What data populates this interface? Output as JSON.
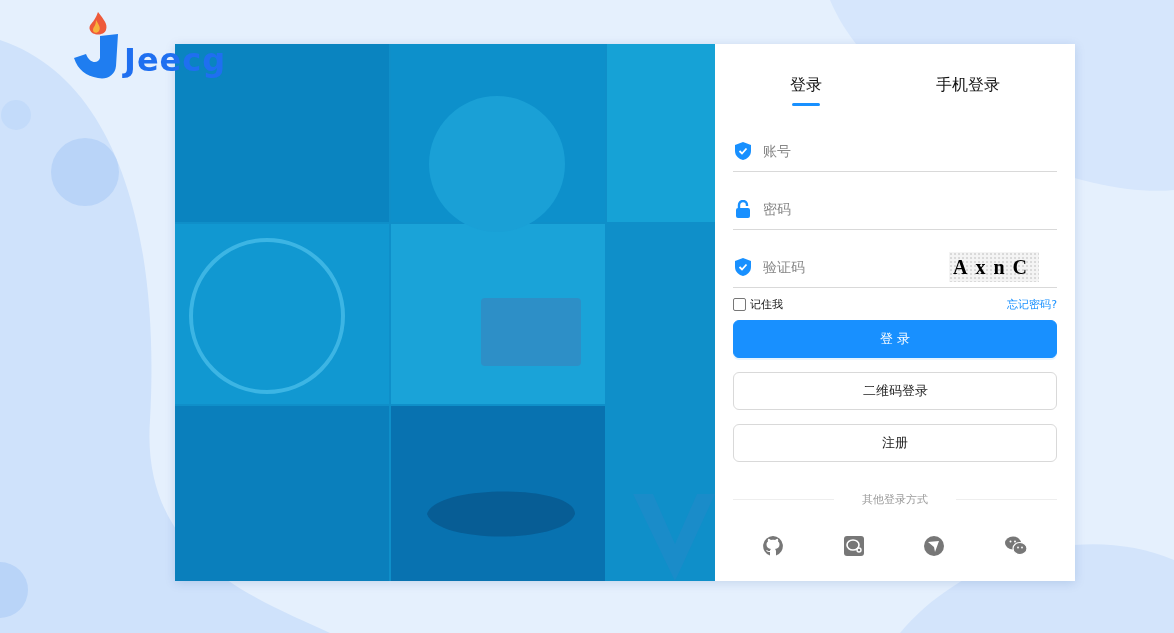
{
  "logo": {
    "text": "Jeecg"
  },
  "tabs": [
    {
      "label": "登录",
      "selected": true
    },
    {
      "label": "手机登录",
      "selected": false
    }
  ],
  "fields": [
    {
      "kind": "account",
      "placeholder": "账号"
    },
    {
      "kind": "password",
      "placeholder": "密码"
    },
    {
      "kind": "captcha",
      "placeholder": "验证码",
      "captcha": "AxnC"
    }
  ],
  "remember": {
    "label": "记住我",
    "checked": false
  },
  "forgot_link": "忘记密码?",
  "buttons": [
    {
      "label": "登 录",
      "kind": "primary"
    },
    {
      "label": "二维码登录",
      "kind": "default"
    },
    {
      "label": "注册",
      "kind": "default"
    }
  ],
  "other_login": {
    "label": "其他登录方式"
  }
}
